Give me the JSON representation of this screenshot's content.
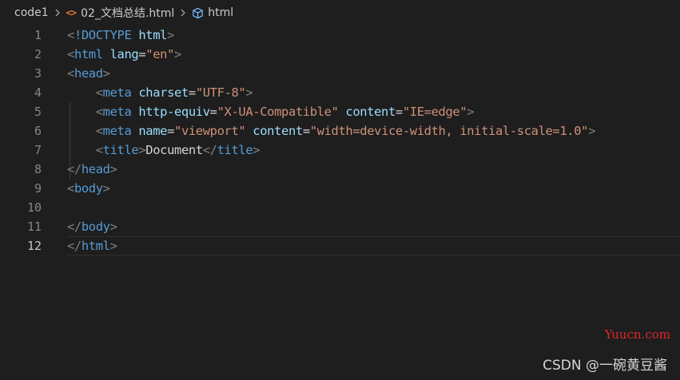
{
  "breadcrumb": {
    "folder": "code1",
    "file_icon": "html-file-icon",
    "file": "02_文档总结.html",
    "symbol_icon": "symbol-cube-icon",
    "symbol": "html"
  },
  "editor": {
    "current_line": 12,
    "lines": [
      {
        "number": "1",
        "tokens": [
          [
            "punc",
            "<"
          ],
          [
            "tag",
            "!DOCTYPE"
          ],
          [
            "txt",
            " "
          ],
          [
            "attr",
            "html"
          ],
          [
            "punc",
            ">"
          ]
        ]
      },
      {
        "number": "2",
        "tokens": [
          [
            "punc",
            "<"
          ],
          [
            "tag",
            "html"
          ],
          [
            "txt",
            " "
          ],
          [
            "attr",
            "lang"
          ],
          [
            "txt",
            "="
          ],
          [
            "str",
            "\"en\""
          ],
          [
            "punc",
            ">"
          ]
        ]
      },
      {
        "number": "3",
        "tokens": [
          [
            "punc",
            "<"
          ],
          [
            "tag",
            "head"
          ],
          [
            "punc",
            ">"
          ]
        ]
      },
      {
        "number": "4",
        "tokens": [
          [
            "txt",
            "    "
          ],
          [
            "punc",
            "<"
          ],
          [
            "tag",
            "meta"
          ],
          [
            "txt",
            " "
          ],
          [
            "attr",
            "charset"
          ],
          [
            "txt",
            "="
          ],
          [
            "str",
            "\"UTF-8\""
          ],
          [
            "punc",
            ">"
          ]
        ]
      },
      {
        "number": "5",
        "tokens": [
          [
            "txt",
            "    "
          ],
          [
            "punc",
            "<"
          ],
          [
            "tag",
            "meta"
          ],
          [
            "txt",
            " "
          ],
          [
            "attr",
            "http-equiv"
          ],
          [
            "txt",
            "="
          ],
          [
            "str",
            "\"X-UA-Compatible\""
          ],
          [
            "txt",
            " "
          ],
          [
            "attr",
            "content"
          ],
          [
            "txt",
            "="
          ],
          [
            "str",
            "\"IE=edge\""
          ],
          [
            "punc",
            ">"
          ]
        ]
      },
      {
        "number": "6",
        "tokens": [
          [
            "txt",
            "    "
          ],
          [
            "punc",
            "<"
          ],
          [
            "tag",
            "meta"
          ],
          [
            "txt",
            " "
          ],
          [
            "attr",
            "name"
          ],
          [
            "txt",
            "="
          ],
          [
            "str",
            "\"viewport\""
          ],
          [
            "txt",
            " "
          ],
          [
            "attr",
            "content"
          ],
          [
            "txt",
            "="
          ],
          [
            "str",
            "\"width=device-width, initial-scale=1.0\""
          ],
          [
            "punc",
            ">"
          ]
        ]
      },
      {
        "number": "7",
        "tokens": [
          [
            "txt",
            "    "
          ],
          [
            "punc",
            "<"
          ],
          [
            "tag",
            "title"
          ],
          [
            "punc",
            ">"
          ],
          [
            "txt",
            "Document"
          ],
          [
            "punc",
            "</"
          ],
          [
            "tag",
            "title"
          ],
          [
            "punc",
            ">"
          ]
        ]
      },
      {
        "number": "8",
        "tokens": [
          [
            "punc",
            "</"
          ],
          [
            "tag",
            "head"
          ],
          [
            "punc",
            ">"
          ]
        ]
      },
      {
        "number": "9",
        "tokens": [
          [
            "punc",
            "<"
          ],
          [
            "tag",
            "body"
          ],
          [
            "punc",
            ">"
          ]
        ]
      },
      {
        "number": "10",
        "tokens": []
      },
      {
        "number": "11",
        "tokens": [
          [
            "punc",
            "</"
          ],
          [
            "tag",
            "body"
          ],
          [
            "punc",
            ">"
          ]
        ]
      },
      {
        "number": "12",
        "tokens": [
          [
            "punc",
            "</"
          ],
          [
            "tag",
            "html"
          ],
          [
            "punc",
            ">"
          ]
        ]
      }
    ]
  },
  "watermarks": {
    "site": "Yuucn.com",
    "author": "CSDN @一碗黄豆酱"
  },
  "colors": {
    "background": "#1e1e1e",
    "tag": "#569cd6",
    "attribute": "#9cdcfe",
    "string": "#ce9178",
    "punctuation": "#808080",
    "line_number": "#858585",
    "html_icon": "#e37933",
    "symbol_icon": "#75beff",
    "watermark_red": "#e0262b"
  }
}
